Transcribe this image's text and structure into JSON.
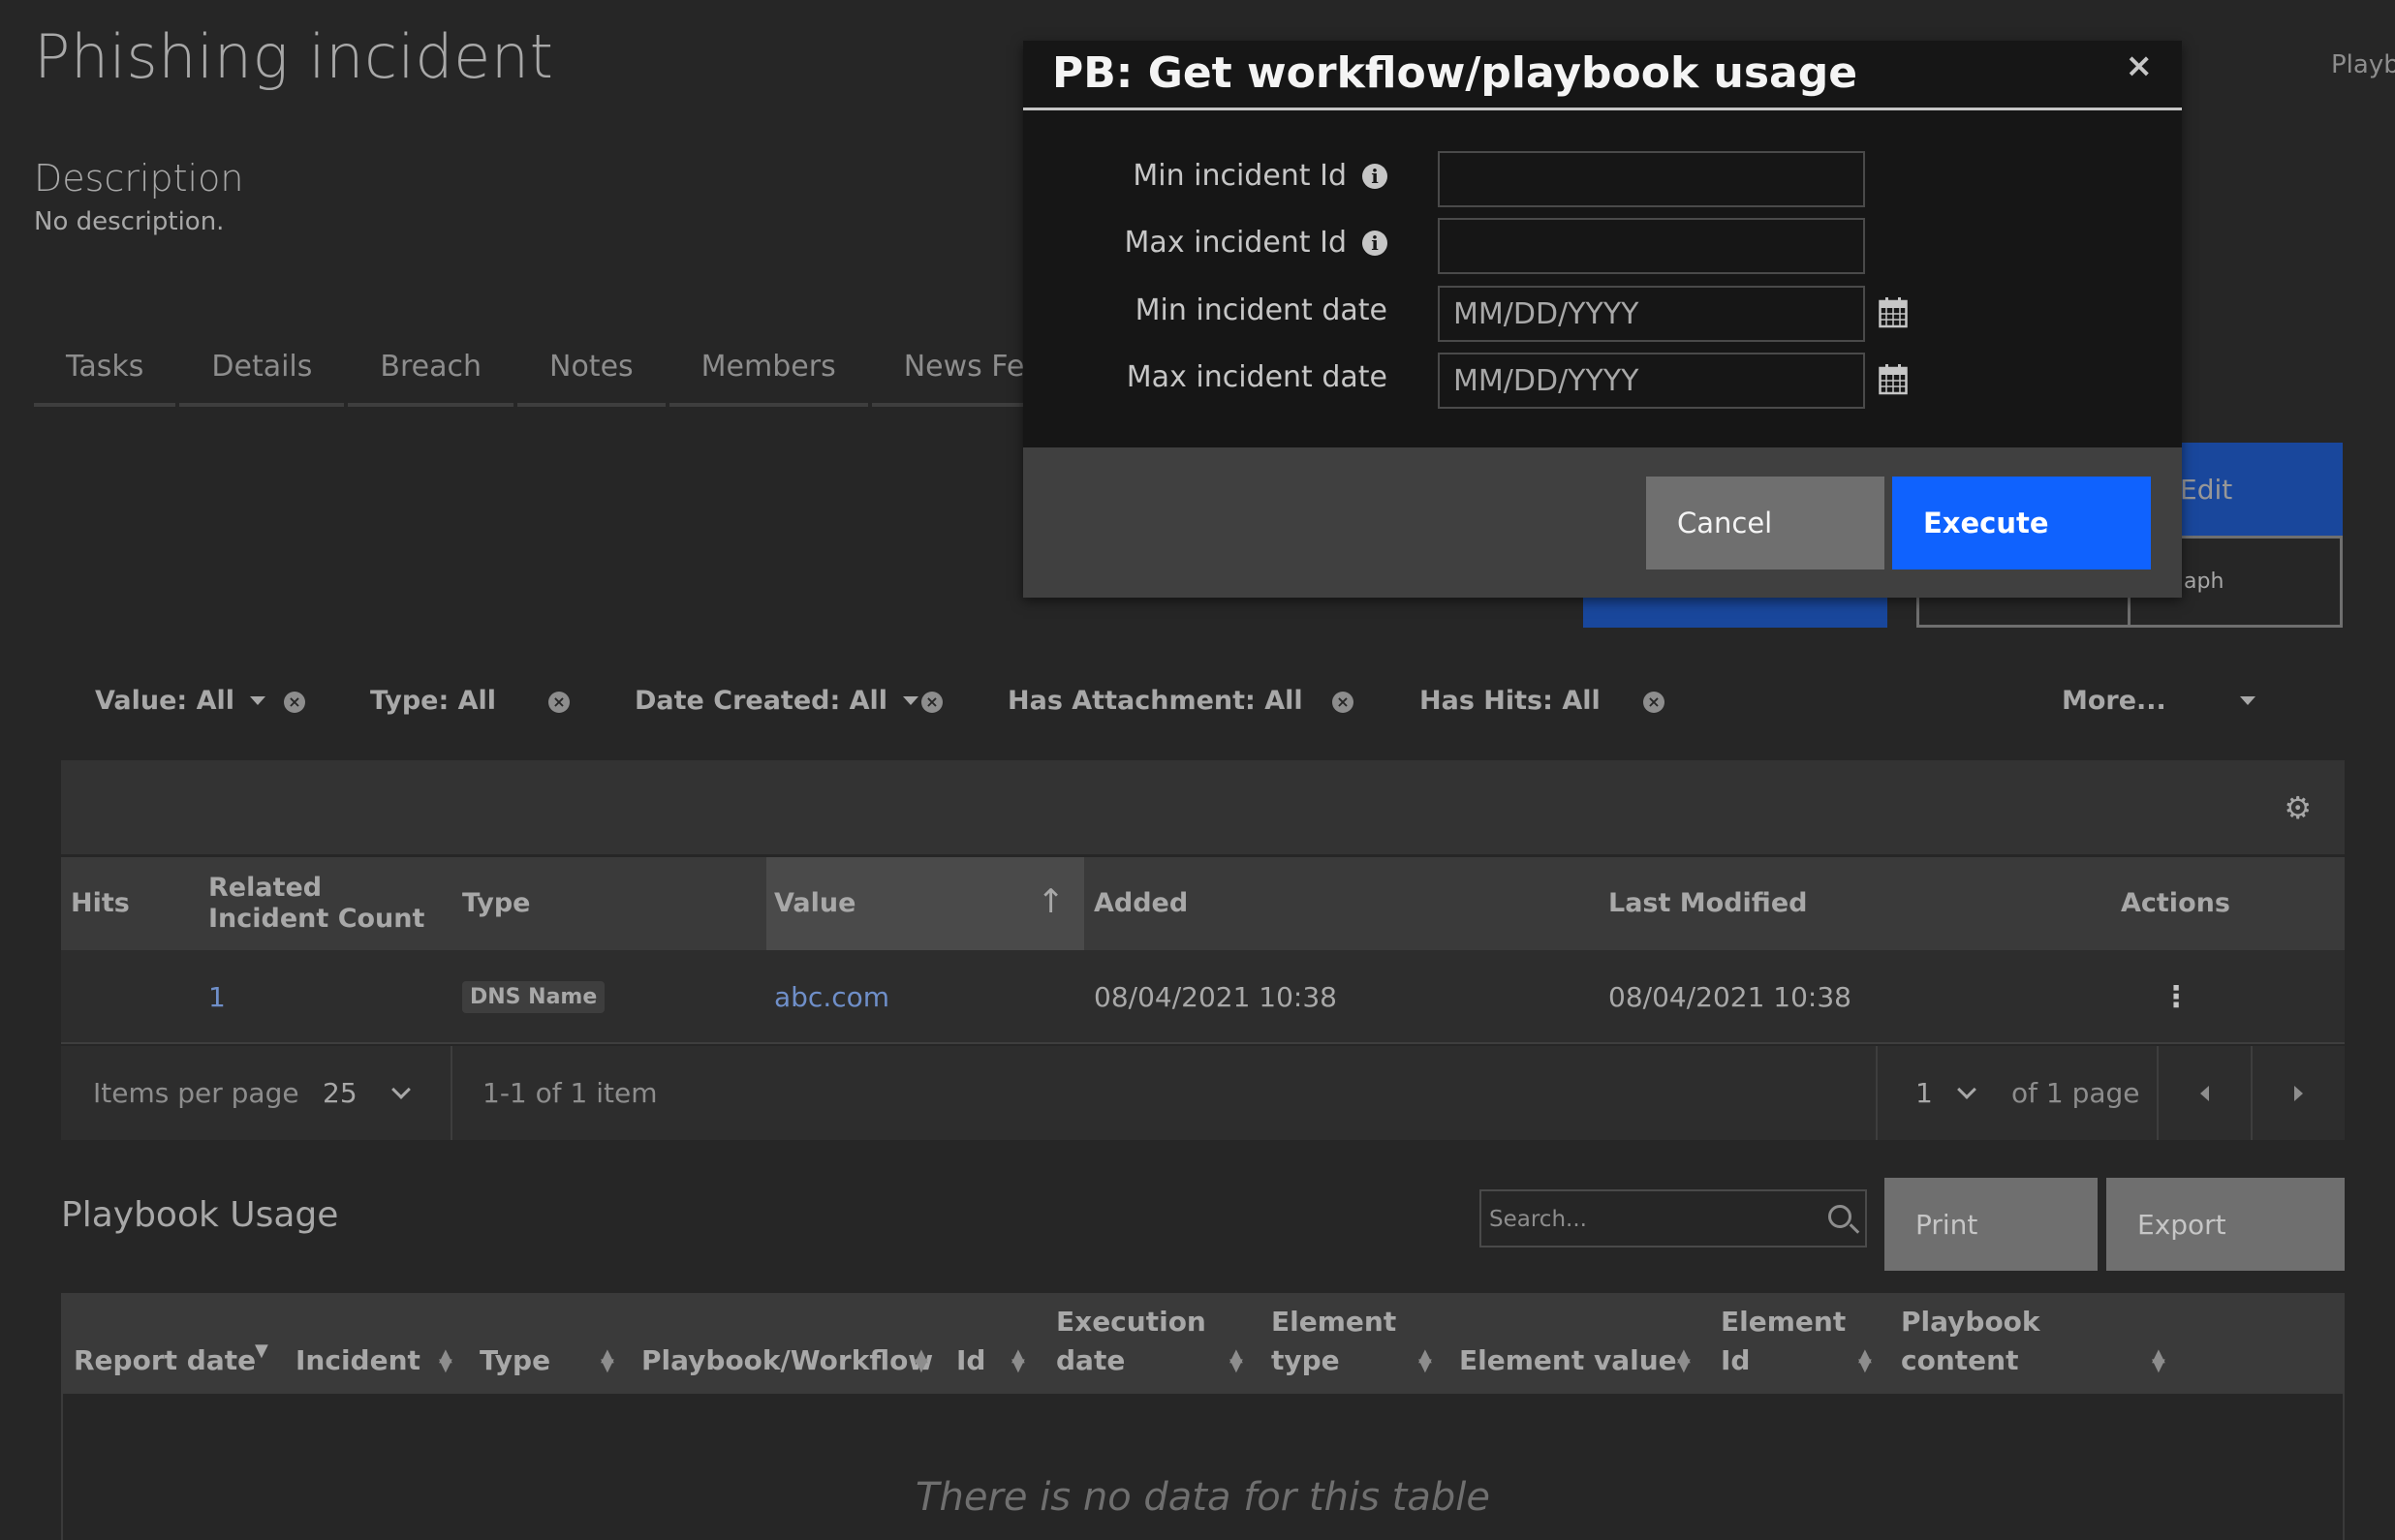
{
  "page": {
    "title": "Phishing incident",
    "top_right_label": "Playb",
    "description_title": "Description",
    "description_text": "No description."
  },
  "tabs": [
    "Tasks",
    "Details",
    "Breach",
    "Notes",
    "Members",
    "News Fee"
  ],
  "background_buttons": {
    "edit_label": "Edit",
    "graph_label": "aph"
  },
  "filters": [
    {
      "label": "Value: All",
      "has_caret": true
    },
    {
      "label": "Type: All",
      "has_caret": false
    },
    {
      "label": "Date Created: All",
      "has_caret": true
    },
    {
      "label": "Has Attachment: All",
      "has_caret": false
    },
    {
      "label": "Has Hits: All",
      "has_caret": false
    }
  ],
  "filters_more": "More...",
  "artifacts_table": {
    "columns": [
      "Hits",
      "Related Incident Count",
      "Type",
      "Value",
      "Added",
      "Last Modified",
      "Actions"
    ],
    "sorted_column": "Value",
    "rows": [
      {
        "hits": "",
        "related_count": "1",
        "type": "DNS Name",
        "value": "abc.com",
        "added": "08/04/2021 10:38",
        "last_modified": "08/04/2021 10:38",
        "actions": "⋮"
      }
    ]
  },
  "pagination": {
    "items_per_page_label": "Items per page",
    "items_per_page": "25",
    "range_text": "1-1 of 1 item",
    "page": "1",
    "of_pages": "of 1 page"
  },
  "playbook_usage": {
    "title": "Playbook Usage",
    "search_placeholder": "Search...",
    "print_label": "Print",
    "export_label": "Export",
    "columns": [
      "Report date",
      "Incident",
      "Type",
      "Playbook/Workflow",
      "Id",
      "Execution date",
      "Element type",
      "Element value",
      "Element Id",
      "Playbook content"
    ],
    "empty_message": "There is no data for this table"
  },
  "modal": {
    "title": "PB: Get workflow/playbook usage",
    "close": "×",
    "fields": [
      {
        "label": "Min incident Id",
        "info": true,
        "placeholder": "",
        "calendar": false
      },
      {
        "label": "Max incident Id",
        "info": true,
        "placeholder": "",
        "calendar": false
      },
      {
        "label": "Min incident date",
        "info": false,
        "placeholder": "MM/DD/YYYY",
        "calendar": true
      },
      {
        "label": "Max incident date",
        "info": false,
        "placeholder": "MM/DD/YYYY",
        "calendar": true
      }
    ],
    "cancel_label": "Cancel",
    "execute_label": "Execute"
  },
  "colors": {
    "background": "#262626",
    "modal": "#161616",
    "primary_button": "#0f62fe",
    "secondary_button": "#6f6f6f",
    "link": "#6f8fc9"
  }
}
